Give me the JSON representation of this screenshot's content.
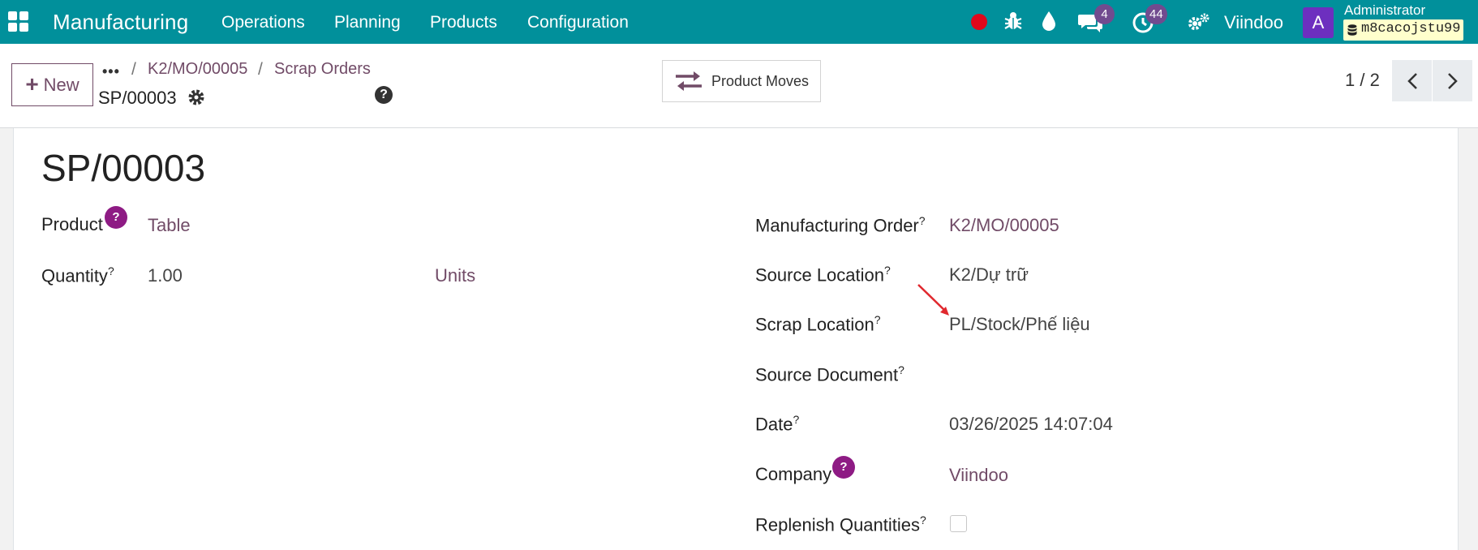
{
  "navbar": {
    "brand": "Manufacturing",
    "menu": [
      "Operations",
      "Planning",
      "Products",
      "Configuration"
    ],
    "messages_count": "4",
    "activities_count": "44",
    "company": "Viindoo",
    "avatar_letter": "A",
    "user": "Administrator",
    "database": "m8cacojstu99",
    "accent_color": "#01909b"
  },
  "control": {
    "new_label": "New",
    "breadcrumb": [
      "K2/MO/00005",
      "Scrap Orders"
    ],
    "record": "SP/00003",
    "product_moves_label": "Product Moves",
    "pager": "1 / 2"
  },
  "form": {
    "title": "SP/00003",
    "left": {
      "product_label": "Product",
      "product_value": "Table",
      "quantity_label": "Quantity",
      "quantity_value": "1.00",
      "uom_value": "Units"
    },
    "right": {
      "mo_label": "Manufacturing Order",
      "mo_value": "K2/MO/00005",
      "source_location_label": "Source Location",
      "source_location_value": "K2/Dự trữ",
      "scrap_location_label": "Scrap Location",
      "scrap_location_value": "PL/Stock/Phế liệu",
      "source_document_label": "Source Document",
      "date_label": "Date",
      "date_value": "03/26/2025 14:07:04",
      "company_label": "Company",
      "company_value": "Viindoo",
      "replenish_label": "Replenish Quantities"
    },
    "help_mark": "?"
  }
}
